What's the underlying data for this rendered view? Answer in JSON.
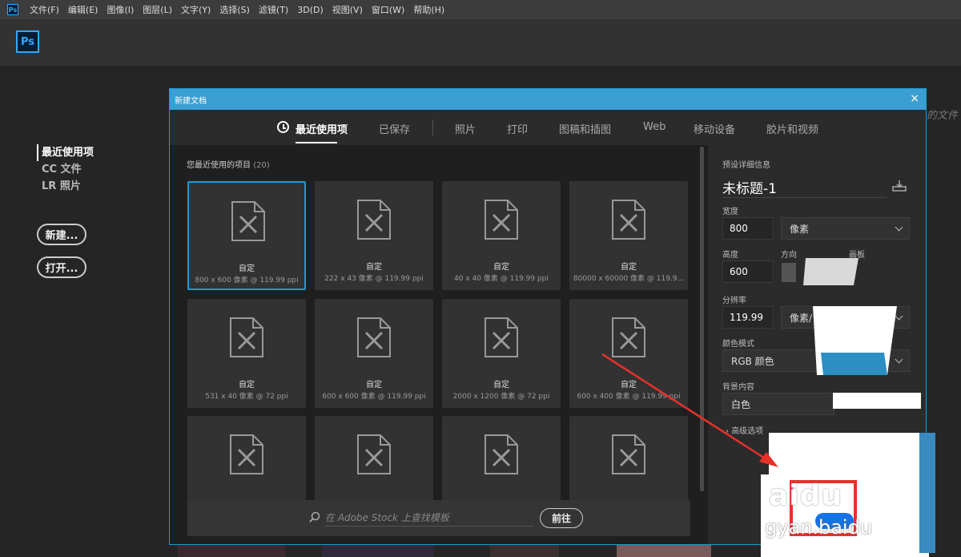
{
  "menubar": {
    "app_icon": "Ps",
    "items": [
      "文件(F)",
      "编辑(E)",
      "图像(I)",
      "图层(L)",
      "文字(Y)",
      "选择(S)",
      "滤镜(T)",
      "3D(D)",
      "视图(V)",
      "窗口(W)",
      "帮助(H)"
    ]
  },
  "header": {
    "logo": "Ps"
  },
  "start": {
    "nav": [
      "最近使用项",
      "CC 文件",
      "LR 照片"
    ],
    "new_button": "新建...",
    "open_button": "打开...",
    "right_hint": "的文件"
  },
  "dialog": {
    "title": "新建文档",
    "close": "×",
    "tabs": [
      "最近使用项",
      "已保存",
      "照片",
      "打印",
      "图稿和插图",
      "Web",
      "移动设备",
      "胶片和视频"
    ],
    "recent_label": "您最近使用的项目",
    "recent_count": "(20)",
    "cards": [
      {
        "title": "自定",
        "sub": "800 x 600 像素 @ 119.99 ppi"
      },
      {
        "title": "自定",
        "sub": "222 x 43 像素 @ 119.99 ppi"
      },
      {
        "title": "自定",
        "sub": "40 x 40 像素 @ 119.99 ppi"
      },
      {
        "title": "自定",
        "sub": "80000 x 60000 像素 @ 119.9..."
      },
      {
        "title": "自定",
        "sub": "531 x 40 像素 @ 72 ppi"
      },
      {
        "title": "自定",
        "sub": "600 x 600 像素 @ 119.99 ppi"
      },
      {
        "title": "自定",
        "sub": "2000 x 1200 像素 @ 72 ppi"
      },
      {
        "title": "自定",
        "sub": "600 x 400 像素 @ 119.99 ppi"
      },
      {
        "title": "",
        "sub": ""
      },
      {
        "title": "",
        "sub": ""
      },
      {
        "title": "",
        "sub": ""
      },
      {
        "title": "",
        "sub": ""
      }
    ],
    "stock_placeholder": "在 Adobe Stock 上查找模板",
    "stock_go": "前往",
    "panel": {
      "header": "预设详细信息",
      "doc_name": "未标题-1",
      "width_label": "宽度",
      "width_value": "800",
      "width_unit": "像素",
      "height_label": "高度",
      "height_value": "600",
      "orientation_label": "方向",
      "artboard_label": "画板",
      "resolution_label": "分辨率",
      "resolution_value": "119.99",
      "resolution_unit": "像素/",
      "color_mode_label": "颜色模式",
      "color_mode_value": "RGB 颜色",
      "background_label": "背景内容",
      "background_value": "白色",
      "advanced": "高级选项",
      "create_button": "创建"
    }
  },
  "watermark": {
    "logo": "aidu",
    "url": "gyan.baidu"
  },
  "colors": {
    "accent": "#1b9ad6",
    "title_bar": "#3a9fd2",
    "annotation": "#e8302a",
    "create": "#1473e6"
  }
}
